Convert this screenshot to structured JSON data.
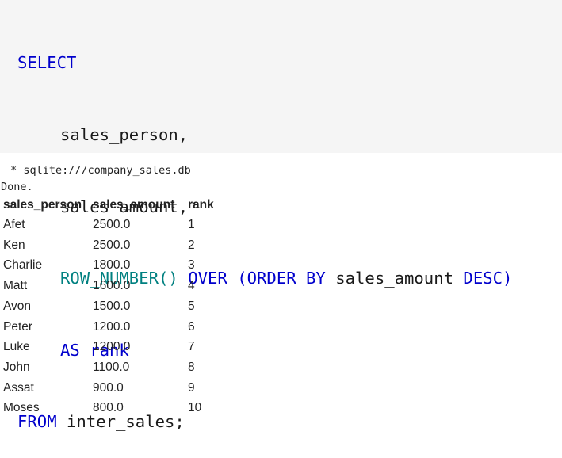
{
  "code": {
    "select_kw": "SELECT",
    "col1": "sales_person,",
    "col2": "sales_amount,",
    "rownum_fn": "ROW_NUMBER()",
    "over_kw": "OVER",
    "order_open": "(ORDER BY",
    "order_col": "sales_amount",
    "desc_close": "DESC)",
    "as_kw": "AS",
    "alias": "rank",
    "from_kw": "FROM",
    "table_name": "inter_sales;"
  },
  "output": {
    "connection": " * sqlite:///company_sales.db",
    "status": "Done.",
    "columns": [
      "sales_person",
      "sales_amount",
      "rank"
    ],
    "rows": [
      [
        "Afet",
        "2500.0",
        "1"
      ],
      [
        "Ken",
        "2500.0",
        "2"
      ],
      [
        "Charlie",
        "1800.0",
        "3"
      ],
      [
        "Matt",
        "1600.0",
        "4"
      ],
      [
        "Avon",
        "1500.0",
        "5"
      ],
      [
        "Peter",
        "1200.0",
        "6"
      ],
      [
        "Luke",
        "1200.0",
        "7"
      ],
      [
        "John",
        "1100.0",
        "8"
      ],
      [
        "Assat",
        "900.0",
        "9"
      ],
      [
        "Moses",
        "800.0",
        "10"
      ]
    ]
  },
  "colors": {
    "keyword": "#0000cc",
    "function": "#008080",
    "code_background": "#f5f5f5"
  }
}
